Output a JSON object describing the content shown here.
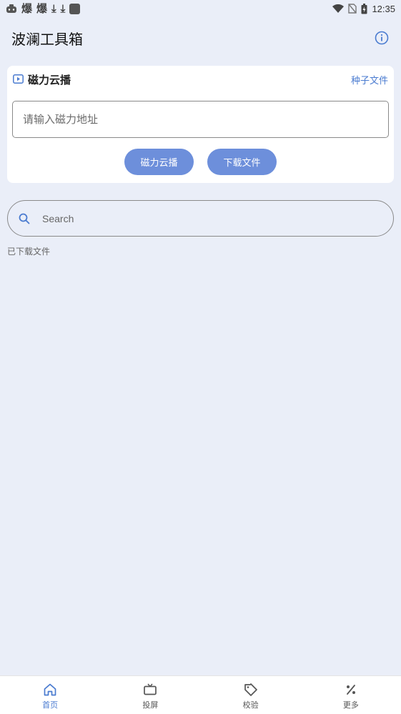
{
  "status_bar": {
    "left_glyphs": [
      "爆",
      "爆",
      "⤓",
      "⤓"
    ],
    "time": "12:35"
  },
  "app_bar": {
    "title": "波澜工具箱",
    "info_icon": "info-icon"
  },
  "magnet_card": {
    "title": "磁力云播",
    "seed_link": "种子文件",
    "input_placeholder": "请输入磁力地址",
    "input_value": "",
    "buttons": {
      "play": "磁力云播",
      "download": "下载文件"
    }
  },
  "search": {
    "placeholder": "Search",
    "value": ""
  },
  "downloaded_label": "已下载文件",
  "bottom_nav": {
    "items": [
      {
        "label": "首页",
        "icon": "home-icon",
        "active": true
      },
      {
        "label": "投屏",
        "icon": "tv-icon",
        "active": false
      },
      {
        "label": "校验",
        "icon": "tag-icon",
        "active": false
      },
      {
        "label": "更多",
        "icon": "percent-icon",
        "active": false
      }
    ]
  },
  "colors": {
    "accent": "#4a7bd0",
    "button": "#6d8fdb",
    "background": "#eaeef8"
  }
}
